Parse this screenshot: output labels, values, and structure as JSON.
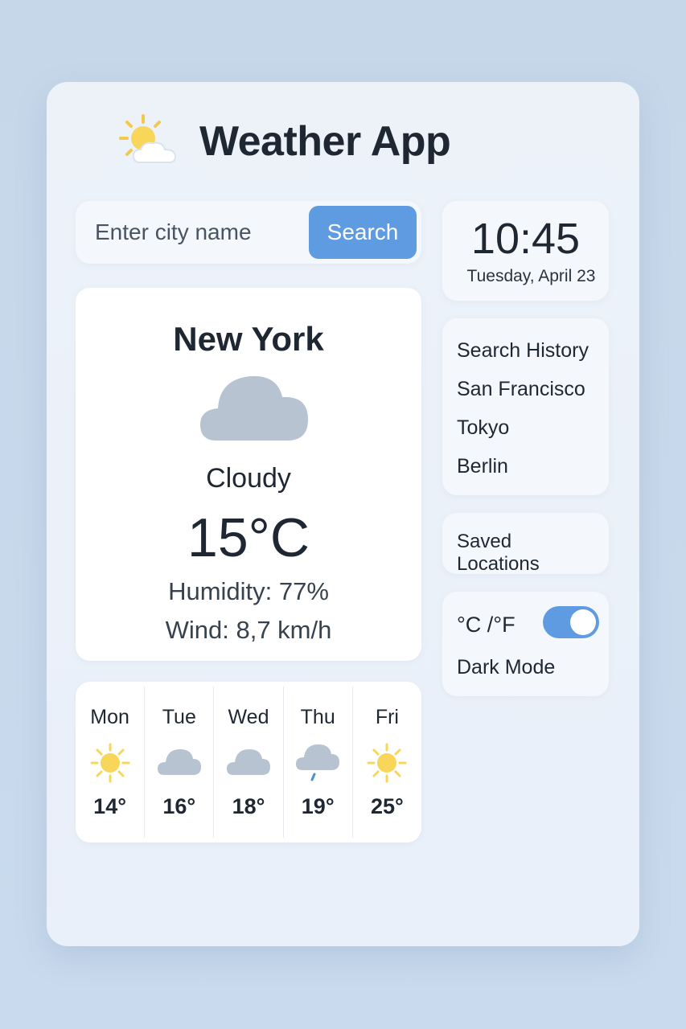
{
  "app": {
    "title": "Weather App",
    "logo_icon": "sun-behind-cloud-icon"
  },
  "search": {
    "placeholder": "Enter city name",
    "value": "",
    "button_label": "Search"
  },
  "current": {
    "city": "New York",
    "condition_icon": "cloud-icon",
    "condition": "Cloudy",
    "temperature": "15°C",
    "humidity": "Humidity: 77%",
    "wind": "Wind: 8,7 km/h"
  },
  "forecast": [
    {
      "day": "Mon",
      "icon": "sun-icon",
      "temp": "14°"
    },
    {
      "day": "Tue",
      "icon": "cloud-icon",
      "temp": "16°"
    },
    {
      "day": "Wed",
      "icon": "cloud-icon",
      "temp": "18°"
    },
    {
      "day": "Thu",
      "icon": "rain-cloud-icon",
      "temp": "19°"
    },
    {
      "day": "Fri",
      "icon": "sun-icon",
      "temp": "25°"
    }
  ],
  "clock": {
    "time": "10:45",
    "date": "Tuesday, April 23"
  },
  "history": {
    "title": "Search History",
    "items": [
      "San Francisco",
      "Tokyo",
      "Berlin"
    ]
  },
  "saved": {
    "label": "Saved Locations"
  },
  "settings": {
    "unit_label": "°C /°F",
    "unit_toggle_on": true,
    "dark_mode_label": "Dark Mode"
  },
  "colors": {
    "accent": "#5f9be0",
    "sun": "#f7d65a",
    "cloud": "#b8c3d1",
    "rain": "#4d8fd6"
  }
}
